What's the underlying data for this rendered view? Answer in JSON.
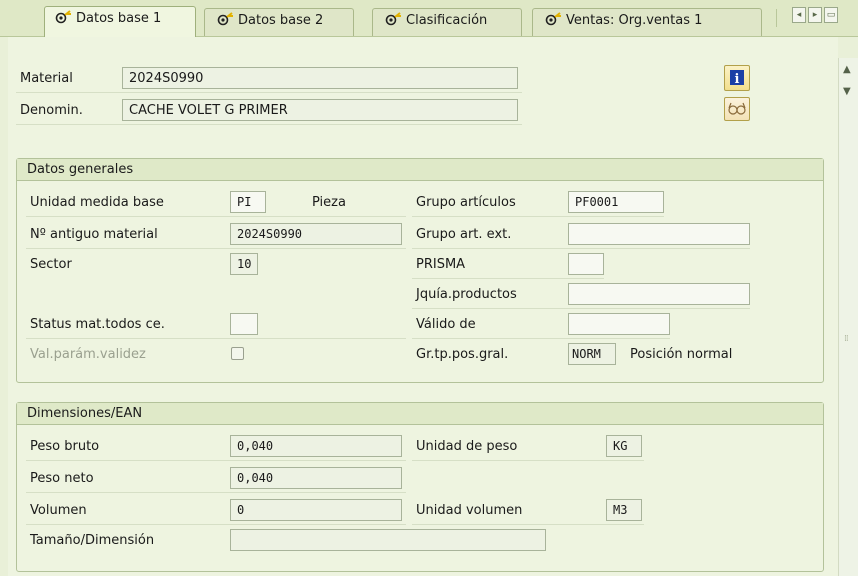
{
  "tabs": [
    {
      "label": "Datos base 1",
      "active": true
    },
    {
      "label": "Datos base 2",
      "active": false
    },
    {
      "label": "Clasificación",
      "active": false
    },
    {
      "label": "Ventas: Org.ventas 1",
      "active": false
    }
  ],
  "header": {
    "material_label": "Material",
    "material_value": "2024S0990",
    "denomin_label": "Denomin.",
    "denomin_value": "CACHE VOLET G PRIMER"
  },
  "datos_generales": {
    "title": "Datos generales",
    "unidad_medida_base_label": "Unidad medida base",
    "unidad_medida_base_value": "PI",
    "unidad_medida_base_text": "Pieza",
    "antiguo_material_label": "Nº antiguo material",
    "antiguo_material_value": "2024S0990",
    "sector_label": "Sector",
    "sector_value": "10",
    "status_label": "Status mat.todos ce.",
    "status_value": "",
    "val_param_label": "Val.parám.validez",
    "grupo_articulos_label": "Grupo artículos",
    "grupo_articulos_value": "PF0001",
    "grupo_art_ext_label": "Grupo art. ext.",
    "grupo_art_ext_value": "",
    "prisma_label": "PRISMA",
    "prisma_value": "",
    "jquia_label": "Jquía.productos",
    "jquia_value": "",
    "valido_de_label": "Válido de",
    "valido_de_value": "",
    "gr_tp_pos_label": "Gr.tp.pos.gral.",
    "gr_tp_pos_value": "NORM",
    "gr_tp_pos_text": "Posición normal"
  },
  "dimensiones": {
    "title": "Dimensiones/EAN",
    "peso_bruto_label": "Peso bruto",
    "peso_bruto_value": "0,040",
    "peso_neto_label": "Peso neto",
    "peso_neto_value": "0,040",
    "volumen_label": "Volumen",
    "volumen_value": "0",
    "tamano_label": "Tamaño/Dimensión",
    "tamano_value": "",
    "unidad_peso_label": "Unidad de peso",
    "unidad_peso_value": "KG",
    "unidad_volumen_label": "Unidad volumen",
    "unidad_volumen_value": "M3"
  },
  "colors": {
    "background": "#e9f0d8",
    "group_header": "#dfe9c8",
    "info_button": "#f2df8e"
  }
}
